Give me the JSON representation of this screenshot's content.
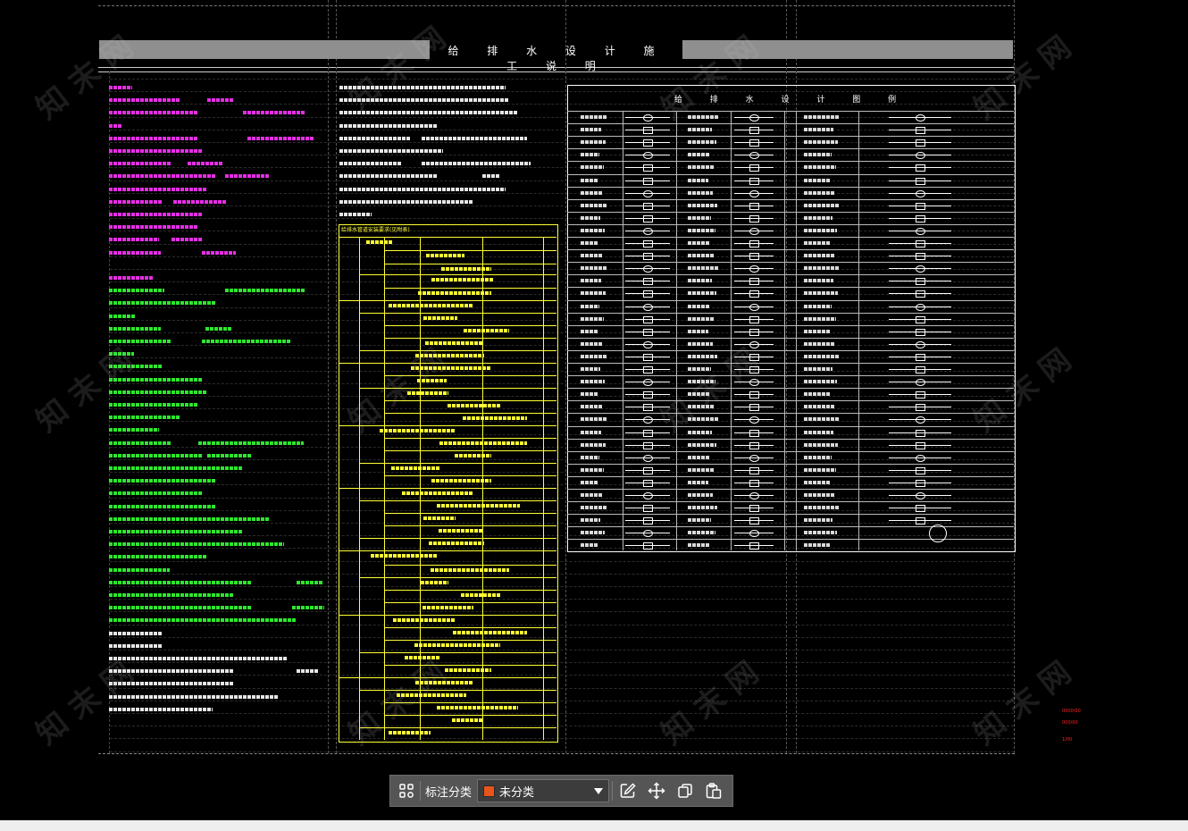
{
  "drawing": {
    "title": "给 排 水 设 计 施 工 说 明",
    "legend_title": "给 排 水 设 计 图 例",
    "table_title": "给排水管道安装要求(见附表)",
    "side_labels": [
      "0000/00",
      "000/00",
      "1/00"
    ],
    "watermark": "知 末 网"
  },
  "toolbar": {
    "grid_icon": "grid-icon",
    "label": "标注分类",
    "select": {
      "value": "未分类",
      "swatch_color": "#e8541a"
    },
    "edit_icon": "edit-icon",
    "move_icon": "move-icon",
    "copy_icon": "copy-icon",
    "paste_icon": "paste-icon"
  },
  "colors": {
    "background": "#000000",
    "notes_magenta": "#ff33ff",
    "notes_green": "#33ff33",
    "notes_white": "#ffffff",
    "table_yellow": "#ffff33",
    "accent_red": "#ff2222"
  }
}
